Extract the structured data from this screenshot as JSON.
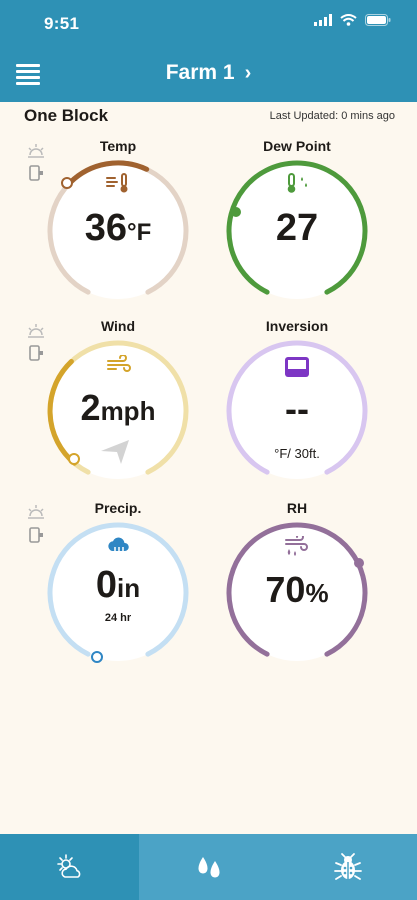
{
  "status_bar": {
    "time": "9:51"
  },
  "nav": {
    "title": "Farm 1",
    "chevron": "›",
    "menu_icon": "menu-icon"
  },
  "block": {
    "name": "One Block",
    "last_updated": "Last Updated: 0 mins ago"
  },
  "gauges": {
    "temp": {
      "label": "Temp",
      "value": "36",
      "unit": "°F",
      "color": "#a0622f",
      "track": "#e3d3c6",
      "icon": "thermometer-wind-icon"
    },
    "dew_point": {
      "label": "Dew Point",
      "value": "27",
      "unit": "",
      "color": "#4e9a3c",
      "track": "#4e9a3c",
      "icon": "thermometer-drops-icon"
    },
    "wind": {
      "label": "Wind",
      "value": "2",
      "unit": "mph",
      "color": "#d4a42b",
      "track": "#f0e0a8",
      "icon": "wind-icon"
    },
    "inversion": {
      "label": "Inversion",
      "value": "--",
      "unit": "°F/ 30ft.",
      "color": "#7d36c4",
      "track": "#d8c6f0",
      "icon": "display-icon"
    },
    "precip": {
      "label": "Precip.",
      "value": "0",
      "unit": "in",
      "sub": "24 hr",
      "color": "#2f86c4",
      "track": "#c4dff3",
      "icon": "cloud-rain-icon"
    },
    "rh": {
      "label": "RH",
      "value": "70",
      "unit": "%",
      "color": "#93709a",
      "track": "#93709a",
      "icon": "humidity-icon"
    }
  },
  "tabs": [
    {
      "name": "weather",
      "icon": "sun-cloud-icon",
      "active": true
    },
    {
      "name": "spray",
      "icon": "drops-icon",
      "active": false
    },
    {
      "name": "pests",
      "icon": "bug-icon",
      "active": false
    }
  ],
  "colors": {
    "header": "#2e91b5",
    "tabbar": "#4ba3c6",
    "background": "#fdf8ef"
  }
}
